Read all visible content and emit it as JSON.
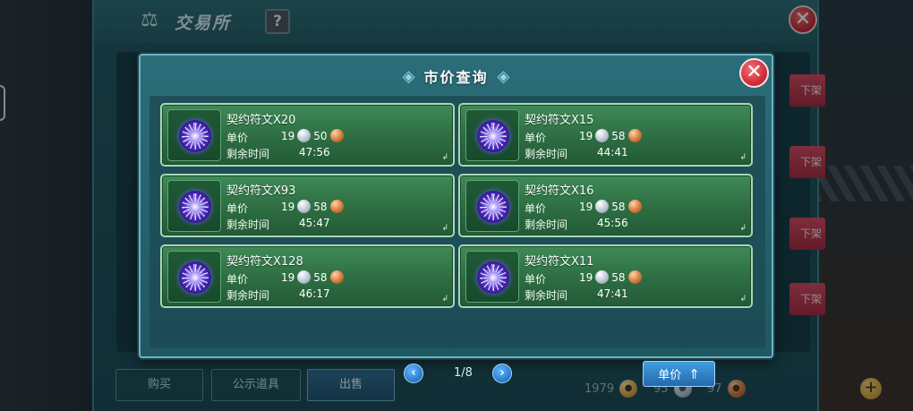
{
  "exchange": {
    "title": "交易所",
    "help": "?",
    "close": "✕",
    "delist_label": "下架",
    "tabs": {
      "buy": "购买",
      "public": "公示道具",
      "sell": "出售"
    },
    "currency": {
      "gold": "1979",
      "silver": "95",
      "copper": "97"
    },
    "add_label": "+"
  },
  "dialog": {
    "title": "市价查询",
    "close": "✕",
    "price_label": "单价",
    "time_label": "剩余时间",
    "corner": "↲",
    "listings": [
      {
        "name": "契约符文X20",
        "silver": "19",
        "copper": "50",
        "time": "47:56"
      },
      {
        "name": "契约符文X15",
        "silver": "19",
        "copper": "58",
        "time": "44:41"
      },
      {
        "name": "契约符文X93",
        "silver": "19",
        "copper": "58",
        "time": "45:47"
      },
      {
        "name": "契约符文X16",
        "silver": "19",
        "copper": "58",
        "time": "45:56"
      },
      {
        "name": "契约符文X128",
        "silver": "19",
        "copper": "58",
        "time": "46:17"
      },
      {
        "name": "契约符文X11",
        "silver": "19",
        "copper": "58",
        "time": "47:41"
      }
    ],
    "pagination": {
      "prev": "‹",
      "next": "›",
      "page": "1/8"
    },
    "sort_button": "单价",
    "icons": {
      "rune": "purple-rune-icon",
      "silver": "silver-coin-icon",
      "copper": "copper-coin-icon",
      "sort": "sort-arrow-icon"
    }
  }
}
